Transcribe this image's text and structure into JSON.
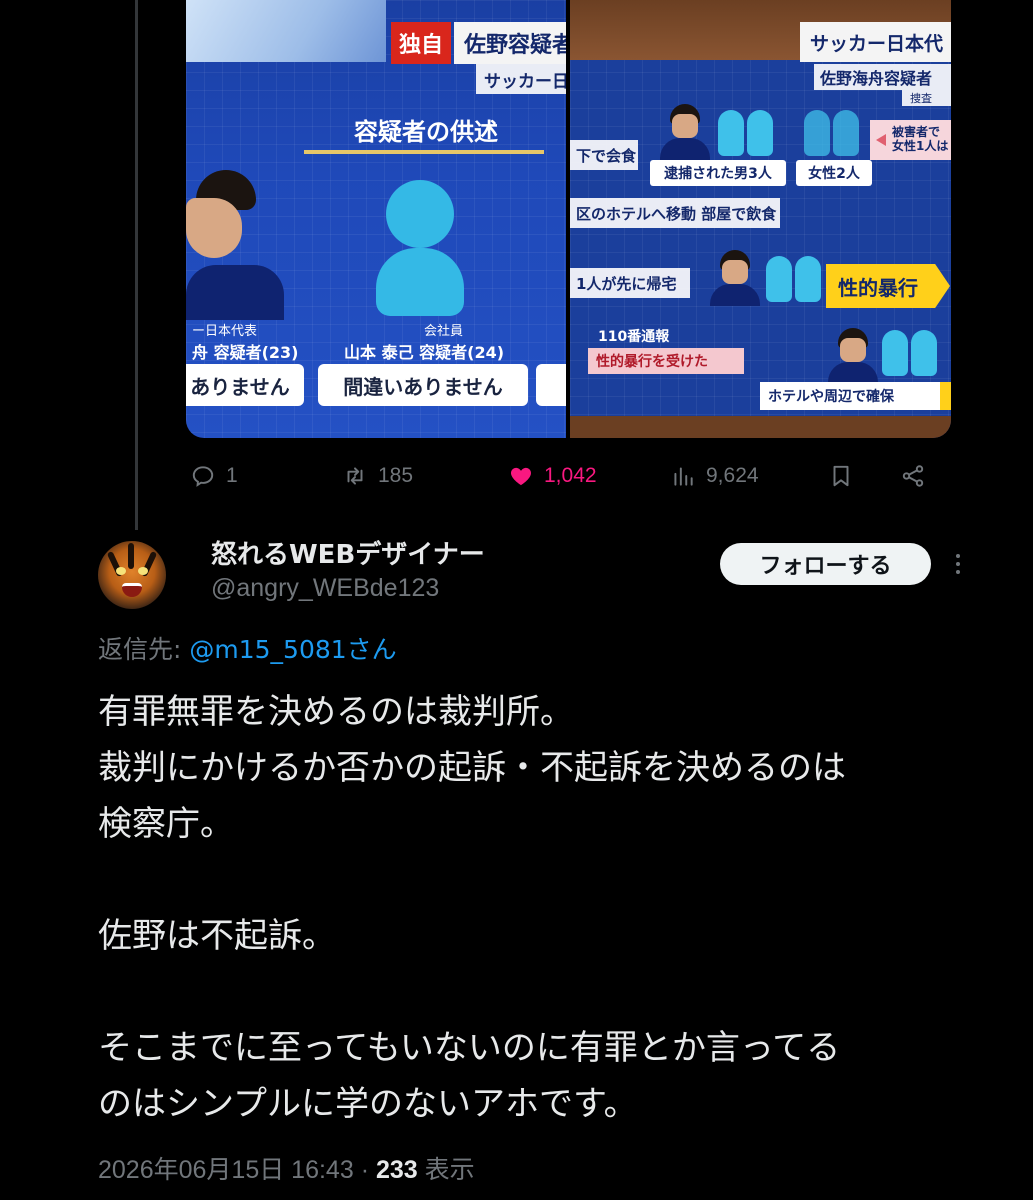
{
  "media": {
    "left_panel": {
      "badge": "独自",
      "headline": "佐野容疑者",
      "sub_headline": "サッカー日",
      "section_title": "容疑者の供述",
      "left_caption_small": "ー日本代表",
      "left_caption_name": "舟 容疑者(23)",
      "mid_caption_small": "会社員",
      "mid_caption_name": "山本 泰己 容疑者(24)",
      "quote_1": "ありません",
      "quote_2": "間違いありません",
      "quote_3": ""
    },
    "right_panel": {
      "headline": "サッカー日本代",
      "sub_headline": "佐野海舟容疑者",
      "note": "捜査",
      "strip_1": "下で会食",
      "label_arrested": "逮捕された男3人",
      "label_women": "女性2人",
      "victim_note": "被害者で\n女性1人は",
      "strip_2": "区のホテルへ移動 部屋で飲食",
      "strip_3": "1人が先に帰宅",
      "arrow_label": "性的暴行",
      "call_label": "110番通報",
      "pink_strip": "性的暴行を受けた",
      "hotel_strip": "ホテルや周辺で確保"
    }
  },
  "actions": {
    "replies": "1",
    "reposts": "185",
    "likes": "1,042",
    "views": "9,624"
  },
  "reply": {
    "display_name": "怒れるWEBデザイナー",
    "handle": "@angry_WEBde123",
    "follow_label": "フォローする",
    "reply_to_prefix": "返信先: ",
    "reply_to_mention": "@m15_5081さん",
    "body_lines": [
      "有罪無罪を決めるのは裁判所。",
      "裁判にかけるか否かの起訴・不起訴を決めるのは",
      "検察庁。",
      "",
      "佐野は不起訴。",
      "",
      "そこまでに至ってもいないのに有罪とか言ってる",
      "のはシンプルに学のないアホです。"
    ],
    "timestamp": "2026年06月15日 16:43",
    "separator": "·",
    "view_count": "233",
    "view_label": "表示"
  },
  "colors": {
    "background": "#000000",
    "text_primary": "#e7e9ea",
    "text_secondary": "#71767b",
    "like_pink": "#f91880",
    "link_blue": "#1d9bf0",
    "follow_bg": "#eff3f4"
  }
}
